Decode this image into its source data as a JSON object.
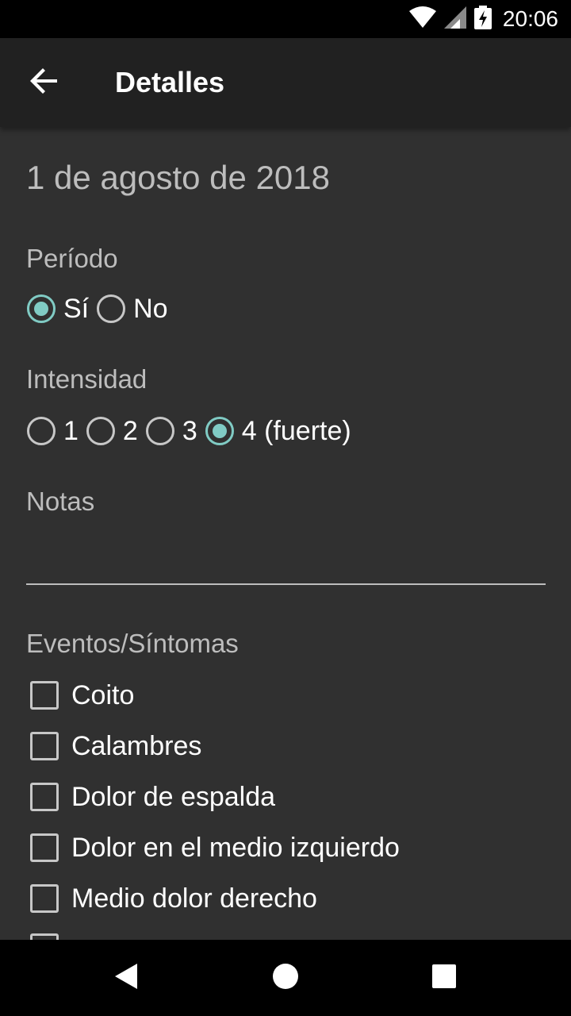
{
  "status_bar": {
    "time": "20:06",
    "icons": [
      "wifi-icon",
      "cell-signal-icon",
      "battery-charging-icon"
    ]
  },
  "app_bar": {
    "title": "Detalles",
    "back_icon": "arrow-back-icon"
  },
  "date": "1 de agosto de 2018",
  "period": {
    "label": "Período",
    "options": [
      {
        "label": "Sí",
        "checked": true
      },
      {
        "label": "No",
        "checked": false
      }
    ]
  },
  "intensity": {
    "label": "Intensidad",
    "options": [
      {
        "label": "1",
        "checked": false
      },
      {
        "label": "2",
        "checked": false
      },
      {
        "label": "3",
        "checked": false
      },
      {
        "label": "4 (fuerte)",
        "checked": true
      }
    ]
  },
  "notes": {
    "label": "Notas",
    "value": ""
  },
  "events": {
    "label": "Eventos/Síntomas",
    "items": [
      {
        "label": "Coito",
        "checked": false
      },
      {
        "label": "Calambres",
        "checked": false
      },
      {
        "label": "Dolor de espalda",
        "checked": false
      },
      {
        "label": "Dolor en el medio izquierdo",
        "checked": false
      },
      {
        "label": "Medio dolor derecho",
        "checked": false
      }
    ]
  },
  "nav_bar": {
    "icons": [
      "back-triangle-icon",
      "home-circle-icon",
      "recents-square-icon"
    ]
  },
  "colors": {
    "accent": "#80cbc4",
    "background": "#303030",
    "app_bar": "#212121"
  }
}
